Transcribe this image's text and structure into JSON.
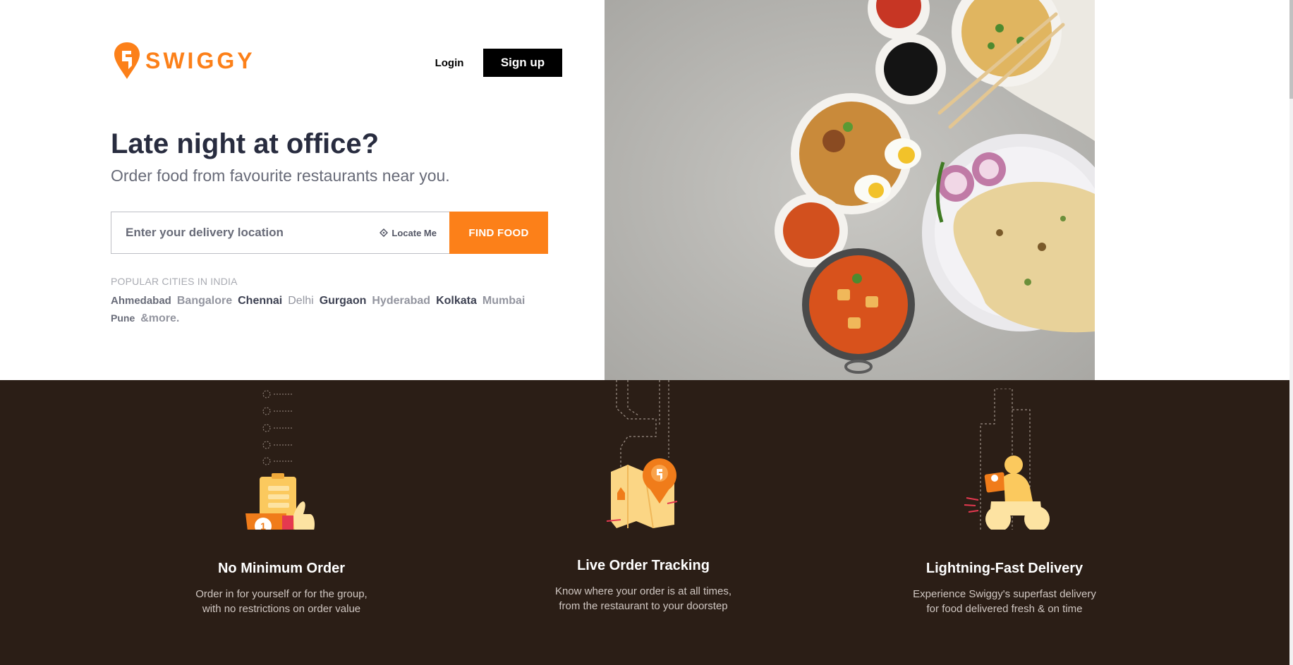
{
  "brand": {
    "name": "SWIGGY",
    "color": "#fc8019"
  },
  "nav": {
    "login": "Login",
    "signup": "Sign up"
  },
  "hero": {
    "headline": "Late night at office?",
    "subheadline": "Order food from favourite restaurants near you."
  },
  "search": {
    "placeholder": "Enter your delivery location",
    "locate_label": "Locate Me",
    "button_label": "FIND FOOD"
  },
  "popular": {
    "title": "POPULAR CITIES IN INDIA",
    "cities": [
      {
        "name": "Ahmedabad",
        "color": "#686b78"
      },
      {
        "name": "Bangalore",
        "color": "#93959f"
      },
      {
        "name": "Chennai",
        "color": "#3d4152"
      },
      {
        "name": "Delhi",
        "color": "#93959f"
      },
      {
        "name": "Gurgaon",
        "color": "#3d4152"
      },
      {
        "name": "Hyderabad",
        "color": "#93959f"
      },
      {
        "name": "Kolkata",
        "color": "#3d4152"
      },
      {
        "name": "Mumbai",
        "color": "#93959f"
      },
      {
        "name": "Pune",
        "color": "#686b78"
      },
      {
        "name": "&more.",
        "color": "#93959f"
      }
    ]
  },
  "features": [
    {
      "title": "No Minimum Order",
      "description": "Order in for yourself or for the group, with no restrictions on order value",
      "icon": "clipboard-thumbs-up-icon"
    },
    {
      "title": "Live Order Tracking",
      "description": "Know where your order is at all times, from the restaurant to your doorstep",
      "icon": "map-pin-icon"
    },
    {
      "title": "Lightning-Fast Delivery",
      "description": "Experience Swiggy's superfast delivery for food delivered fresh & on time",
      "icon": "delivery-scooter-icon"
    }
  ]
}
